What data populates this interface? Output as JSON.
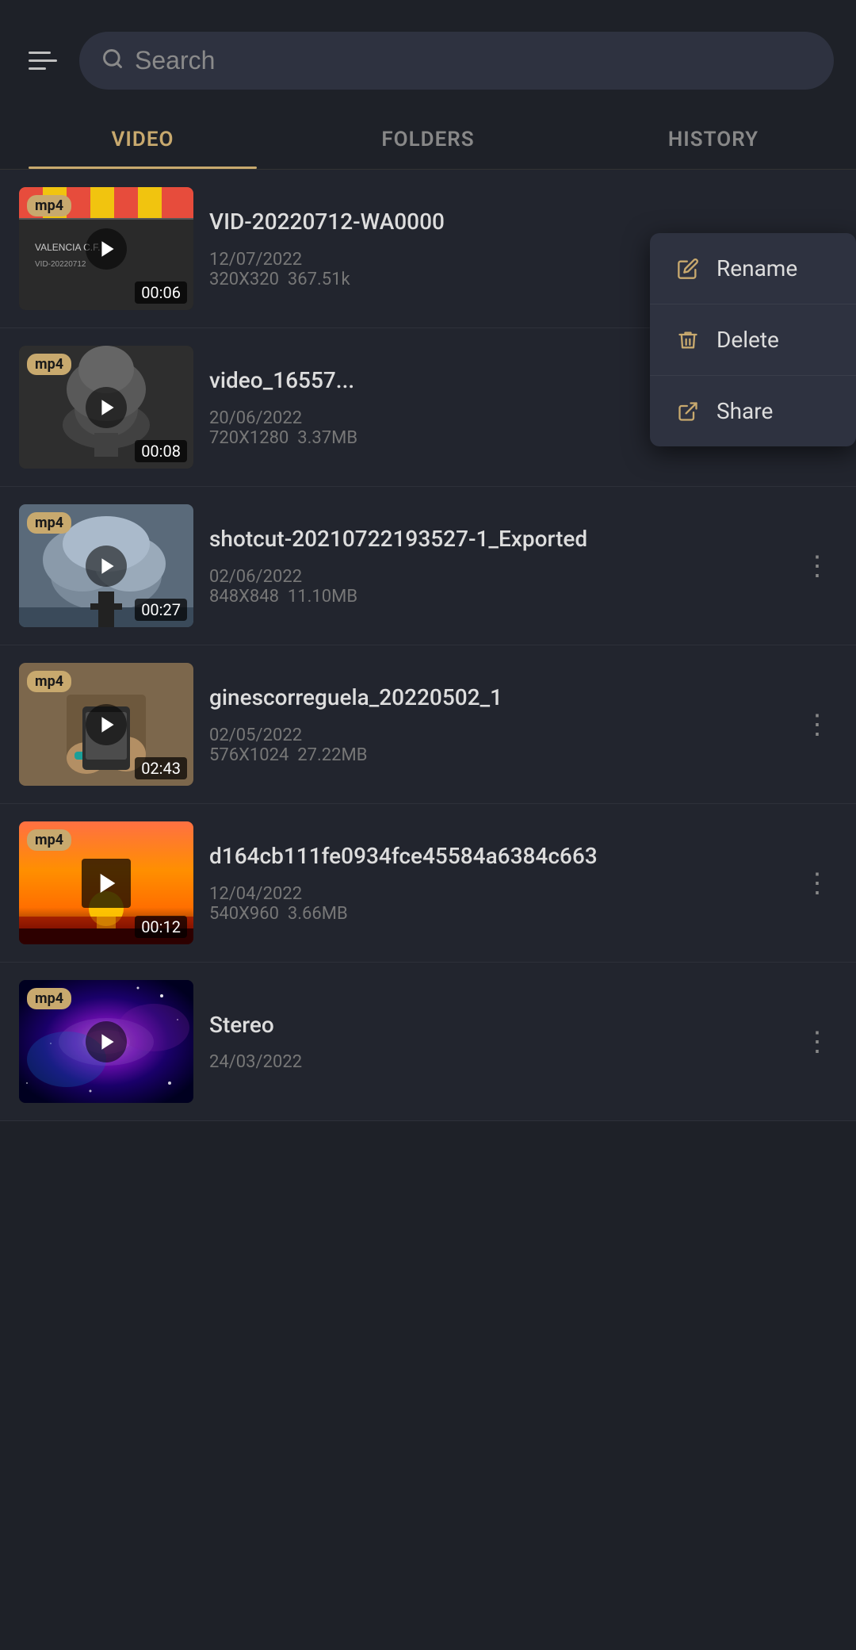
{
  "header": {
    "search_placeholder": "Search"
  },
  "tabs": [
    {
      "id": "video",
      "label": "VIDEO",
      "active": true
    },
    {
      "id": "folders",
      "label": "FOLDERS",
      "active": false
    },
    {
      "id": "history",
      "label": "HISTORY",
      "active": false
    }
  ],
  "context_menu": {
    "items": [
      {
        "id": "rename",
        "label": "Rename",
        "icon": "rename-icon"
      },
      {
        "id": "delete",
        "label": "Delete",
        "icon": "delete-icon"
      },
      {
        "id": "share",
        "label": "Share",
        "icon": "share-icon"
      }
    ]
  },
  "videos": [
    {
      "id": "vid1",
      "title": "VID-20220712-WA0000",
      "date": "12/07/2022",
      "resolution": "320X320",
      "size": "367.51k",
      "duration": "00:06",
      "format": "mp4",
      "thumb_type": "clapboard",
      "has_context_menu": false,
      "context_open": true
    },
    {
      "id": "vid2",
      "title": "video_16557...",
      "date": "20/06/2022",
      "resolution": "720X1280",
      "size": "3.37MB",
      "duration": "00:08",
      "format": "mp4",
      "thumb_type": "explosion",
      "has_context_menu": false,
      "context_open": false
    },
    {
      "id": "vid3",
      "title": "shotcut-20210722193527-1_Exported",
      "date": "02/06/2022",
      "resolution": "848X848",
      "size": "11.10MB",
      "duration": "00:27",
      "format": "mp4",
      "thumb_type": "smoke",
      "has_context_menu": true,
      "context_open": false
    },
    {
      "id": "vid4",
      "title": "ginescorreguela_20220502_1",
      "date": "02/05/2022",
      "resolution": "576X1024",
      "size": "27.22MB",
      "duration": "02:43",
      "format": "mp4",
      "thumb_type": "hands",
      "has_context_menu": true,
      "context_open": false
    },
    {
      "id": "vid5",
      "title": "d164cb111fe0934fce45584a6384c663",
      "date": "12/04/2022",
      "resolution": "540X960",
      "size": "3.66MB",
      "duration": "00:12",
      "format": "mp4",
      "thumb_type": "sunset",
      "has_context_menu": true,
      "context_open": false
    },
    {
      "id": "vid6",
      "title": "Stereo",
      "date": "24/03/2022",
      "resolution": "",
      "size": "",
      "duration": "",
      "format": "mp4",
      "thumb_type": "galaxy",
      "has_context_menu": true,
      "context_open": false
    }
  ]
}
